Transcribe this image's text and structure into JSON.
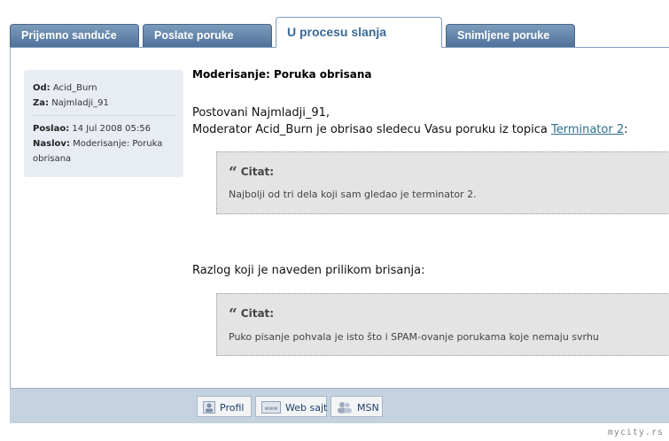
{
  "tabs": [
    {
      "label": "Prijemno sanduče"
    },
    {
      "label": "Poslate poruke"
    },
    {
      "label": "U procesu slanja"
    },
    {
      "label": "Snimljene poruke"
    }
  ],
  "message_meta": {
    "from_label": "Od:",
    "from_value": "Acid_Burn",
    "to_label": "Za:",
    "to_value": "Najmladji_91",
    "sent_label": "Poslao:",
    "sent_value": "14 Jul 2008 05:56",
    "title_label": "Naslov:",
    "title_value": "Moderisanje: Poruka obrisana"
  },
  "message": {
    "subject": "Moderisanje: Poruka obrisana",
    "greeting": "Postovani Najmladji_91,",
    "line2_prefix": "Moderator Acid_Burn je obrisao sledecu Vasu poruku iz topica ",
    "topic_link": "Terminator 2",
    "line2_suffix": ":",
    "reason_line": "Razlog koji je naveden prilikom brisanja:"
  },
  "quotes": [
    {
      "header": "Citat:",
      "text": "Najbolji od tri dela koji sam gledao je terminator 2."
    },
    {
      "header": "Citat:",
      "text": "Puko pisanje pohvala je isto što i SPAM-ovanje porukama koje nemaju svrhu"
    }
  ],
  "footer_buttons": [
    {
      "label": "Profil",
      "icon": "profile-icon"
    },
    {
      "label": "Web sajt",
      "icon": "www-icon"
    },
    {
      "label": "MSN",
      "icon": "msn-icon"
    }
  ],
  "watermark": "mycity.rs"
}
